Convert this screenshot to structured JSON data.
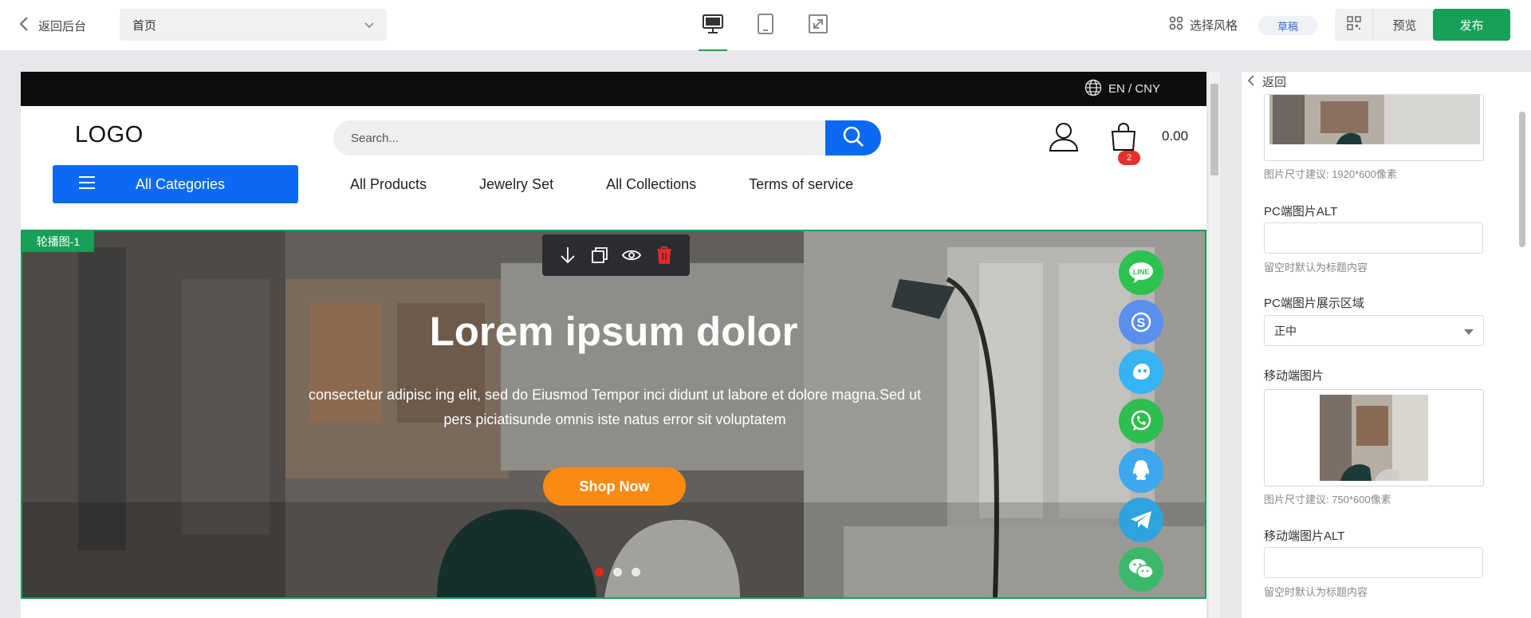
{
  "topbar": {
    "back_label": "返回后台",
    "page_select_value": "首页",
    "devices": [
      "desktop-icon",
      "tablet-icon",
      "fullscreen-icon"
    ],
    "theme_label": "选择风格",
    "status_badge": "草稿",
    "preview_label": "预览",
    "publish_label": "发布",
    "accent_color": "#18a058"
  },
  "site": {
    "locale": "EN / CNY",
    "logo": "LOGO",
    "search_placeholder": "Search...",
    "cart_count": "2",
    "cart_total": "0.00",
    "all_categories": "All Categories",
    "nav": [
      "All Products",
      "Jewelry Set",
      "All Collections",
      "Terms of service"
    ],
    "brand_color": "#0b6af1"
  },
  "banner": {
    "tag": "轮播图-1",
    "title": "Lorem ipsum dolor",
    "subtitle": "consectetur adipisc ing elit, sed do Eiusmod Tempor inci didunt ut labore et dolore magna.Sed ut pers piciatisunde omnis iste natus error sit voluptatem",
    "button": "Shop Now",
    "button_color": "#fb8a14",
    "active_slide": 1,
    "slide_count": 3,
    "tools": [
      "move-down-icon",
      "copy-icon",
      "eye-icon",
      "delete-icon"
    ],
    "socials": [
      "line-icon",
      "skype-icon",
      "messenger-bot-icon",
      "whatsapp-icon",
      "qq-icon",
      "telegram-icon",
      "wechat-icon"
    ]
  },
  "panel": {
    "back_label": "返回",
    "pc_image_hint": "图片尺寸建议: 1920*600像素",
    "pc_alt_label": "PC端图片ALT",
    "pc_alt_value": "",
    "pc_alt_hint": "留空时默认为标题内容",
    "pc_area_label": "PC端图片展示区域",
    "pc_area_value": "正中",
    "mobile_image_label": "移动端图片",
    "mobile_image_hint": "图片尺寸建议: 750*600像素",
    "mobile_alt_label": "移动端图片ALT",
    "mobile_alt_value": "",
    "mobile_alt_hint": "留空时默认为标题内容"
  }
}
